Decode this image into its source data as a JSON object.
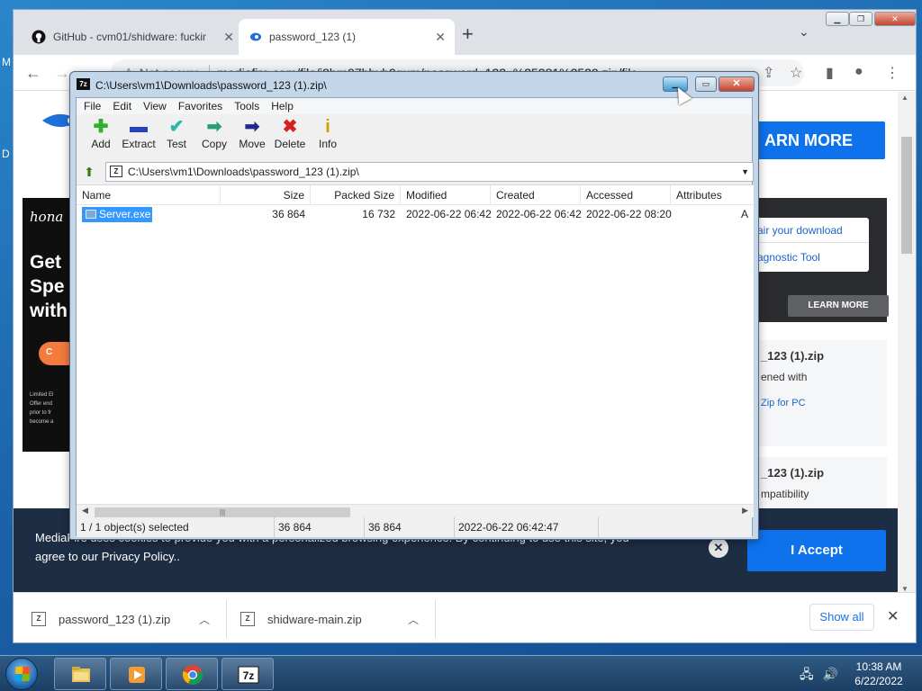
{
  "browser": {
    "tabs": [
      {
        "label": "GitHub - cvm01/shidware: fucking",
        "active": false
      },
      {
        "label": "password_123 (1)",
        "active": true
      }
    ],
    "address": {
      "security_label": "Not secure",
      "url": "mediafire.com/file/j8hrn97bbyb9gum/password_123_%25281%2529.zip/file"
    },
    "page": {
      "learn_more_big": "ARN MORE",
      "ad_left": {
        "brand": "hona",
        "headline_lines": [
          "Get",
          "Spe",
          "with"
        ],
        "button_text": "C",
        "fine_print": [
          "Limited El",
          "Offer end",
          "prior to fr",
          "become a"
        ]
      },
      "ad_right": {
        "line1": "air your download",
        "line2": "agnostic Tool",
        "button": "LEARN MORE"
      },
      "card1": {
        "title": "_123 (1).zip",
        "line": "ened with",
        "link": "Zip for PC"
      },
      "card2": {
        "title": "_123 (1).zip",
        "line": "mpatibility"
      },
      "cookie": {
        "text_line1": "MediaFire uses cookies to provide you with a personalized browsing experience. By continuing to use this site, you",
        "text_line2": "agree to our Privacy Policy..",
        "accept": "I Accept"
      }
    },
    "downloads": {
      "items": [
        "password_123 (1).zip",
        "shidware-main.zip"
      ],
      "show_all": "Show all"
    }
  },
  "sevenzip": {
    "title": "C:\\Users\\vm1\\Downloads\\password_123 (1).zip\\",
    "menu": [
      "File",
      "Edit",
      "View",
      "Favorites",
      "Tools",
      "Help"
    ],
    "toolbar": [
      {
        "label": "Add",
        "icon": "add-icon",
        "glyph": "✚",
        "color": "#2bb02b"
      },
      {
        "label": "Extract",
        "icon": "extract-icon",
        "glyph": "▬",
        "color": "#2a3fbf"
      },
      {
        "label": "Test",
        "icon": "test-icon",
        "glyph": "✔",
        "color": "#2bb7b0"
      },
      {
        "label": "Copy",
        "icon": "copy-icon",
        "glyph": "➡",
        "color": "#2a9c7a"
      },
      {
        "label": "Move",
        "icon": "move-icon",
        "glyph": "➡",
        "color": "#1f2a8c"
      },
      {
        "label": "Delete",
        "icon": "delete-icon",
        "glyph": "✖",
        "color": "#d42020"
      },
      {
        "label": "Info",
        "icon": "info-icon",
        "glyph": "i",
        "color": "#c8a400"
      }
    ],
    "path": "C:\\Users\\vm1\\Downloads\\password_123 (1).zip\\",
    "columns": [
      "Name",
      "Size",
      "Packed Size",
      "Modified",
      "Created",
      "Accessed",
      "Attributes"
    ],
    "rows": [
      {
        "name": "Server.exe",
        "size": "36 864",
        "packed": "16 732",
        "modified": "2022-06-22 06:42",
        "created": "2022-06-22 06:42",
        "accessed": "2022-06-22 08:20",
        "attributes": "A"
      }
    ],
    "status": {
      "selection": "1 / 1 object(s) selected",
      "size": "36 864",
      "packed": "36 864",
      "modified": "2022-06-22 06:42:47"
    }
  },
  "taskbar": {
    "clock_time": "10:38 AM",
    "clock_date": "6/22/2022"
  }
}
